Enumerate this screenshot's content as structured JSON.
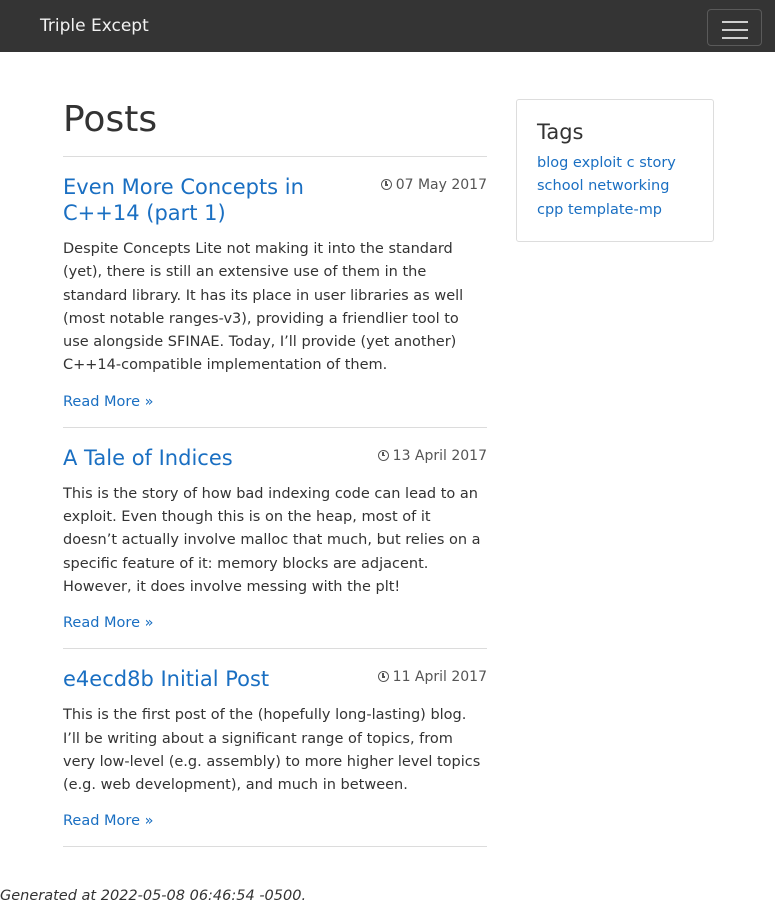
{
  "navbar": {
    "brand": "Triple Except",
    "toggle_icon": "hamburger-menu-icon"
  },
  "main": {
    "title": "Posts",
    "posts": [
      {
        "title": "Even More Concepts in C++14 (part 1)",
        "date": "07 May 2017",
        "excerpt": "Despite Concepts Lite not making it into the standard (yet), there is still an extensive use of them in the standard library. It has its place in user libraries as well (most notable ranges-v3), providing a friendlier tool to use alongside SFINAE. Today, I’ll provide (yet another) C++14-compatible implementation of them.",
        "read_more": "Read More »"
      },
      {
        "title": "A Tale of Indices",
        "date": "13 April 2017",
        "excerpt": "This is the story of how bad indexing code can lead to an exploit. Even though this is on the heap, most of it doesn’t actually involve malloc that much, but relies on a specific feature of it: memory blocks are adjacent. However, it does involve messing with the plt!",
        "read_more": "Read More »"
      },
      {
        "title": "e4ecd8b Initial Post",
        "date": "11 April 2017",
        "excerpt": "This is the first post of the (hopefully long-lasting) blog. I’ll be writing about a significant range of topics, from very low-level (e.g. assembly) to more higher level topics (e.g. web development), and much in between.",
        "read_more": "Read More »"
      }
    ]
  },
  "sidebar": {
    "title": "Tags",
    "tags": [
      "blog",
      "exploit",
      "c",
      "story",
      "school",
      "networking",
      "cpp",
      "template-mp"
    ]
  },
  "footer": {
    "text": "Generated at 2022-05-08 06:46:54 -0500."
  },
  "colors": {
    "navbar_bg": "#343434",
    "link": "#1a6fc2"
  }
}
